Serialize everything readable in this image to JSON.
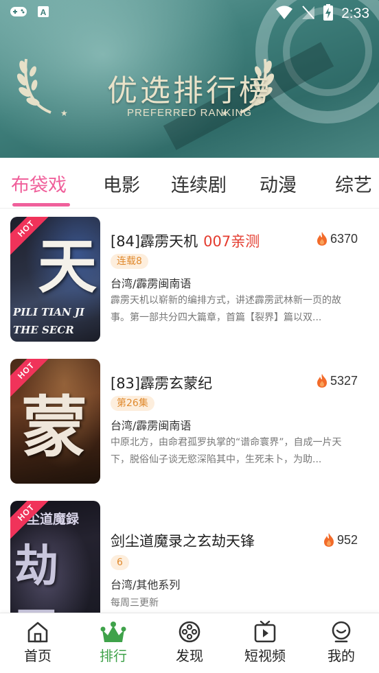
{
  "status_bar": {
    "time": "2:33",
    "icons": [
      "gamepad-icon",
      "a-icon",
      "wifi-icon",
      "signal-off-icon",
      "battery-charging-icon"
    ]
  },
  "banner": {
    "title": "优选排行榜",
    "subtitle": "PREFERRED RANKING",
    "colors": {
      "background": "#3f7f7b",
      "text": "#e9e2c9"
    }
  },
  "tabs": [
    {
      "label": "布袋戏",
      "active": true
    },
    {
      "label": "电影",
      "active": false
    },
    {
      "label": "连续剧",
      "active": false
    },
    {
      "label": "动漫",
      "active": false
    },
    {
      "label": "综艺",
      "active": false
    }
  ],
  "items": [
    {
      "title": "[84]霹雳天机",
      "tested": "007亲测",
      "heat": "6370",
      "badge": "连载8",
      "region": "台湾/霹雳闽南语",
      "description": "霹雳天机以崭新的编排方式，讲述霹雳武林新一页的故事。第一部共分四大篇章，首篇【裂界】篇以双...",
      "hot_label": "HOT",
      "poster_text": "天",
      "poster_caption": "PILI TIAN JI THE SECR"
    },
    {
      "title": "[83]霹雳玄蒙纪",
      "tested": "",
      "heat": "5327",
      "badge": "第26集",
      "region": "台湾/霹雳闽南语",
      "description": "中原北方，由命君孤罗执掌的“谱命寰界”，自成一片天下，脱俗仙子谈无慾深陷其中，生死未卜，为助...",
      "hot_label": "HOT",
      "poster_text": "蒙"
    },
    {
      "title": "剑尘道魔录之玄劫天锋",
      "tested": "",
      "heat": "952",
      "badge": "6",
      "region": "台湾/其他系列",
      "description": "每周三更新",
      "hot_label": "HOT",
      "poster_text": "劫天",
      "poster_caption": "尘道魔録"
    }
  ],
  "bottom_nav": [
    {
      "label": "首页",
      "icon": "home-icon",
      "active": false
    },
    {
      "label": "排行",
      "icon": "crown-icon",
      "active": true
    },
    {
      "label": "发现",
      "icon": "film-reel-icon",
      "active": false
    },
    {
      "label": "短视频",
      "icon": "video-icon",
      "active": false
    },
    {
      "label": "我的",
      "icon": "profile-icon",
      "active": false
    }
  ],
  "colors": {
    "accent_pink": "#f0609b",
    "accent_green": "#3fa24a",
    "tested_red": "#e43b2e",
    "badge_orange": "#e08a2e"
  }
}
